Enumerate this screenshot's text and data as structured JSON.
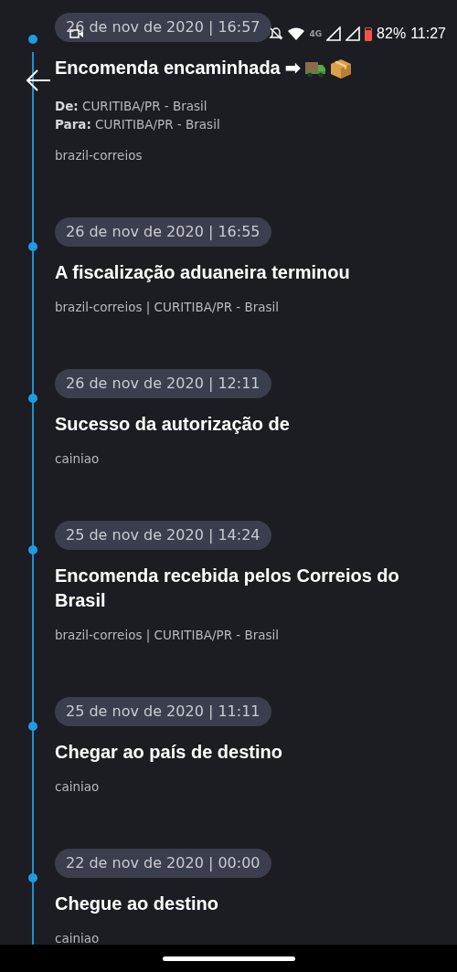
{
  "status_bar": {
    "network": "4G",
    "battery": "82%",
    "time": "11:27"
  },
  "events": [
    {
      "date": "26 de nov de 2020 | 16:57",
      "title": "Encomenda encaminhada ➡",
      "title_icons": [
        {
          "kind": "truck"
        },
        {
          "kind": "box"
        }
      ],
      "route": [
        "**De:** CURITIBA/PR - Brasil",
        "**Para:** CURITIBA/PR - Brasil"
      ],
      "source": "brazil-correios"
    },
    {
      "date": "26 de nov de 2020 | 16:55",
      "title": "A fiscalização aduaneira terminou",
      "source": "brazil-correios | CURITIBA/PR - Brasil"
    },
    {
      "date": "26 de nov de 2020 | 12:11",
      "title": "Sucesso da autorização de",
      "source": "cainiao"
    },
    {
      "date": "25 de nov de 2020 | 14:24",
      "title": "Encomenda recebida pelos Correios do Brasil",
      "source": "brazil-correios | CURITIBA/PR - Brasil"
    },
    {
      "date": "25 de nov de 2020 | 11:11",
      "title": "Chegar ao país de destino",
      "source": "cainiao"
    },
    {
      "date": "22 de nov de 2020 | 00:00",
      "title": "Chegue ao destino",
      "source": "cainiao"
    }
  ]
}
